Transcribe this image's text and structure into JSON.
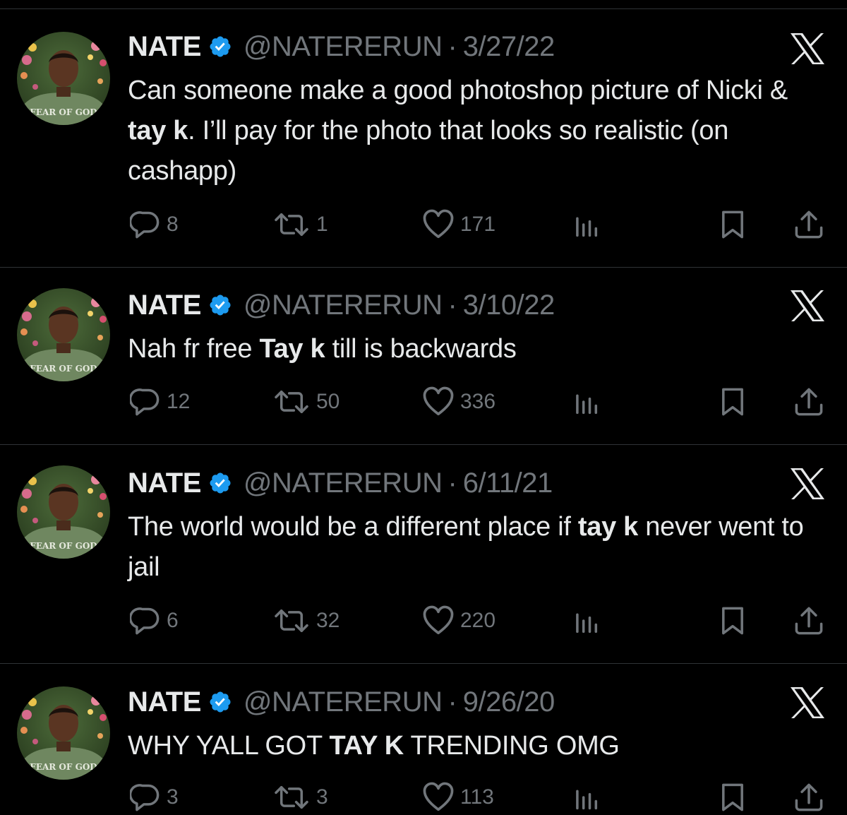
{
  "colors": {
    "background": "#000000",
    "text": "#e7e9ea",
    "secondary": "#71767b",
    "verified": "#1d9bf0",
    "divider": "#2f3336"
  },
  "avatar_shirt_text": "FEAR OF GOD",
  "tweets": [
    {
      "name": "NATE",
      "handle": "@NATERERUN",
      "separator": "·",
      "date": "3/27/22",
      "text_parts": [
        {
          "text": "Can someone make a good photoshop picture of Nicki & ",
          "bold": false
        },
        {
          "text": "tay k",
          "bold": true
        },
        {
          "text": ". I’ll pay for the photo that looks so realistic (on cashapp)",
          "bold": false
        }
      ],
      "replies": "8",
      "retweets": "1",
      "likes": "171"
    },
    {
      "name": "NATE",
      "handle": "@NATERERUN",
      "separator": "·",
      "date": "3/10/22",
      "text_parts": [
        {
          "text": "Nah fr free ",
          "bold": false
        },
        {
          "text": "Tay k",
          "bold": true
        },
        {
          "text": " till is backwards",
          "bold": false
        }
      ],
      "replies": "12",
      "retweets": "50",
      "likes": "336"
    },
    {
      "name": "NATE",
      "handle": "@NATERERUN",
      "separator": "·",
      "date": "6/11/21",
      "text_parts": [
        {
          "text": "The world would be a different place if ",
          "bold": false
        },
        {
          "text": "tay k",
          "bold": true
        },
        {
          "text": " never went to jail",
          "bold": false
        }
      ],
      "replies": "6",
      "retweets": "32",
      "likes": "220"
    },
    {
      "name": "NATE",
      "handle": "@NATERERUN",
      "separator": "·",
      "date": "9/26/20",
      "text_parts": [
        {
          "text": "WHY YALL GOT ",
          "bold": false
        },
        {
          "text": "TAY K",
          "bold": true
        },
        {
          "text": " TRENDING OMG",
          "bold": false
        }
      ],
      "replies": "3",
      "retweets": "3",
      "likes": "113"
    }
  ]
}
